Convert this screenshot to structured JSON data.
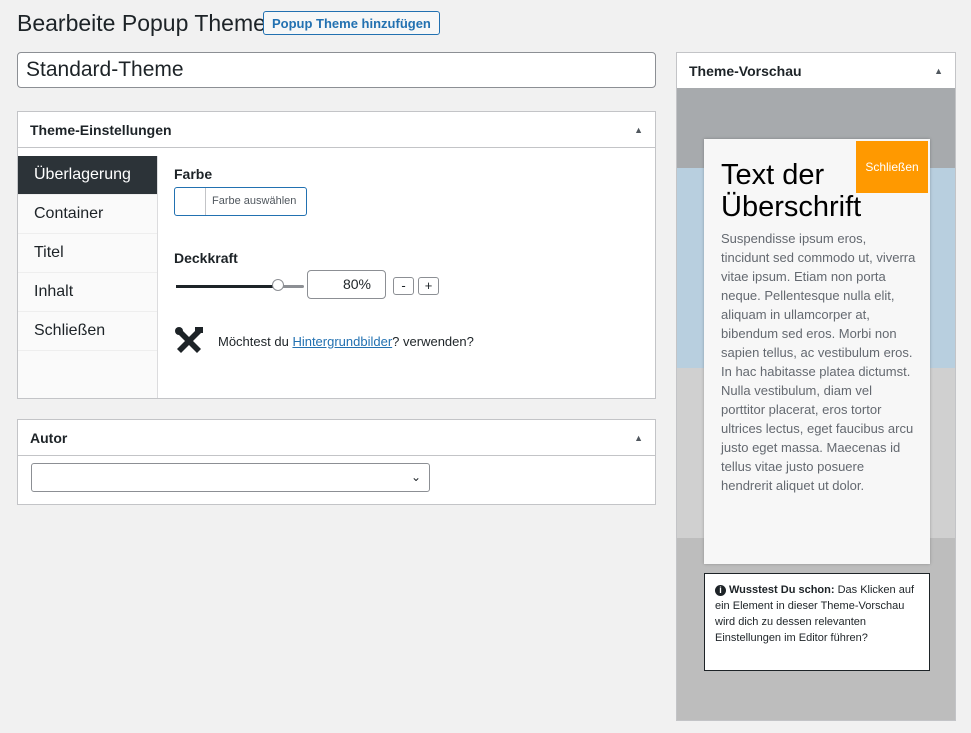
{
  "header": {
    "title": "Bearbeite Popup Theme",
    "add_button": "Popup Theme hinzufügen"
  },
  "theme_name": "Standard-Theme",
  "settings": {
    "title": "Theme-Einstellungen",
    "tabs": [
      {
        "label": "Überlagerung",
        "active": true
      },
      {
        "label": "Container",
        "active": false
      },
      {
        "label": "Titel",
        "active": false
      },
      {
        "label": "Inhalt",
        "active": false
      },
      {
        "label": "Schließen",
        "active": false
      }
    ],
    "color_label": "Farbe",
    "color_button": "Farbe auswählen",
    "opacity_label": "Deckkraft",
    "opacity_value": "80%",
    "opacity_fraction": 0.8,
    "minus": "-",
    "plus": "+",
    "bg_prefix": "Möchtest du ",
    "bg_link": "Hintergrundbilder",
    "bg_suffix": "? verwenden?"
  },
  "author": {
    "title": "Autor",
    "selected": "",
    "chevron": "⌄"
  },
  "preview": {
    "title": "Theme-Vorschau",
    "popup_close": "Schließen",
    "popup_title": "Text der Überschrift",
    "popup_body": "Suspendisse ipsum eros, tincidunt sed commodo ut, viverra vitae ipsum. Etiam non porta neque. Pellentesque nulla elit, aliquam in ullamcorper at, bibendum sed eros. Morbi non sapien tellus, ac vestibulum eros. In hac habitasse platea dictumst. Nulla vestibulum, diam vel porttitor placerat, eros tortor ultrices lectus, eget faucibus arcu justo eget massa. Maecenas id tellus vitae justo posuere hendrerit aliquet ut dolor.",
    "tip_icon": "i",
    "tip_bold": "Wusstest Du schon:",
    "tip_text": " Das Klicken auf ein Element in dieser Theme-Vorschau wird dich zu dessen relevanten Einstellungen im Editor führen?"
  },
  "toggle_symbol": "▲",
  "colors": {
    "accent": "#2271b1",
    "active_tab": "#2c3338",
    "close_button": "#ff9900"
  }
}
